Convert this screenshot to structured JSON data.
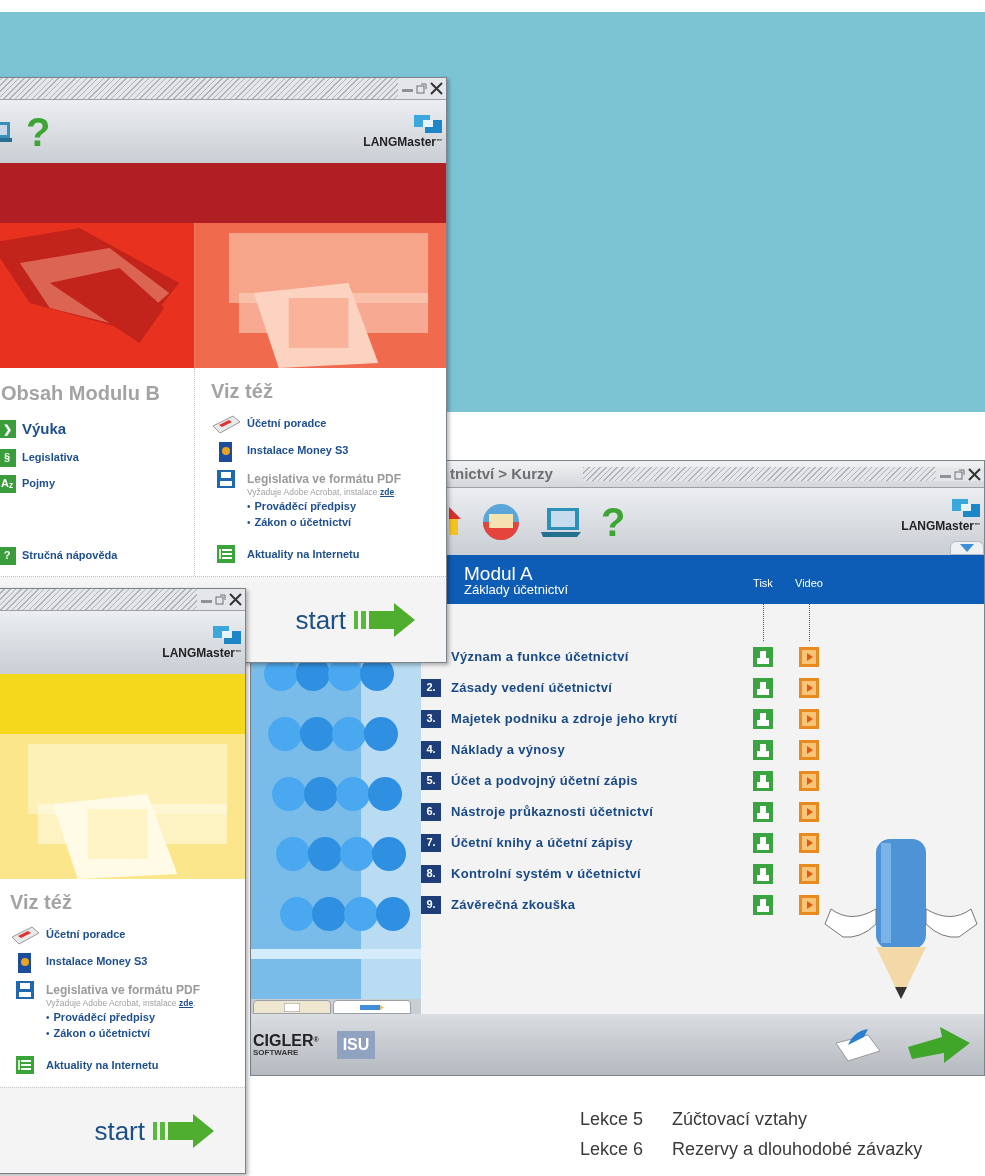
{
  "module_b_window": {
    "kind": "red",
    "help": "?",
    "logo": "LANGMaster",
    "logo_tm": "™",
    "contents": {
      "heading": "Obsah Modulu B",
      "items": [
        {
          "kind": "main",
          "icon": "❯",
          "label": "Výuka"
        },
        {
          "kind": "link",
          "icon": "§",
          "label": "Legislativa"
        },
        {
          "kind": "link",
          "icon": "A$_{z}$",
          "label": "Pojmy"
        },
        {
          "kind": "help",
          "icon": "?",
          "label": "Stručná nápověda"
        }
      ]
    },
    "see_also": {
      "heading": "Viz též",
      "items": [
        {
          "kind": "book",
          "label": "Účetní poradce"
        },
        {
          "kind": "box",
          "label": "Instalace Money S3"
        },
        {
          "kind": "pdf",
          "label": "Legislativa ve formátu PDF",
          "note": "Vyžaduje Adobe Acrobat, instalace ",
          "note_link": "zde",
          "note_end": ".",
          "links": [
            {
              "bullet": "•",
              "label": "Prováděcí předpisy"
            },
            {
              "bullet": "•",
              "label": "Zákon o účetnictví"
            }
          ]
        },
        {
          "kind": "news",
          "label": "Aktuality na Internetu"
        }
      ]
    },
    "start": "start"
  },
  "module_a_window": {
    "title": "tnictví > Kurzy",
    "help": "?",
    "logo": "LANGMaster",
    "logo_tm": "™",
    "module": "Modul A",
    "subtitle": "Základy účetnictví",
    "columns": [
      "Tisk",
      "Video"
    ],
    "lessons": [
      {
        "title": "Význam a funkce účetnictví"
      },
      {
        "number": "2.",
        "title": "Zásady vedení účetnictví"
      },
      {
        "number": "3.",
        "title": "Majetek podniku a zdroje jeho krytí"
      },
      {
        "number": "4.",
        "title": "Náklady a výnosy"
      },
      {
        "number": "5.",
        "title": "Účet a podvojný účetní zápis"
      },
      {
        "number": "6.",
        "title": "Nástroje průkaznosti účetnictví"
      },
      {
        "number": "7.",
        "title": "Účetní knihy a účetní zápisy"
      },
      {
        "number": "8.",
        "title": "Kontrolní systém v účetnictví"
      },
      {
        "number": "9.",
        "title": "Závěrečná zkouška"
      }
    ],
    "tabs": [
      {
        "kind": "note",
        "selected": false
      },
      {
        "kind": "pencil",
        "selected": true
      }
    ],
    "brand": "CIGLER",
    "brand_tm": "®",
    "brand_sub": "SOFTWARE",
    "partner": "ISU"
  },
  "module_window_yellow": {
    "kind": "yellow",
    "logo": "LANGMaster",
    "logo_tm": "™",
    "see_also": {
      "heading": "Viz též",
      "items": [
        {
          "kind": "book",
          "label": "Účetní poradce"
        },
        {
          "kind": "box",
          "label": "Instalace Money S3"
        },
        {
          "kind": "pdf",
          "label": "Legislativa ve formátu PDF",
          "note": "Vyžaduje Adobe Acrobat, instalace ",
          "note_link": "zde",
          "note_end": ".",
          "links": [
            {
              "bullet": "•",
              "label": "Prováděcí předpisy"
            },
            {
              "bullet": "•",
              "label": "Zákon o účetnictví"
            }
          ]
        },
        {
          "kind": "news",
          "label": "Aktuality na Internetu"
        }
      ]
    },
    "start": "start"
  },
  "lesson_list": [
    {
      "label": "Lekce 5",
      "title": "Zúčtovací vztahy"
    },
    {
      "label": "Lekce 6",
      "title": "Rezervy a dlouhodobé závazky"
    }
  ]
}
